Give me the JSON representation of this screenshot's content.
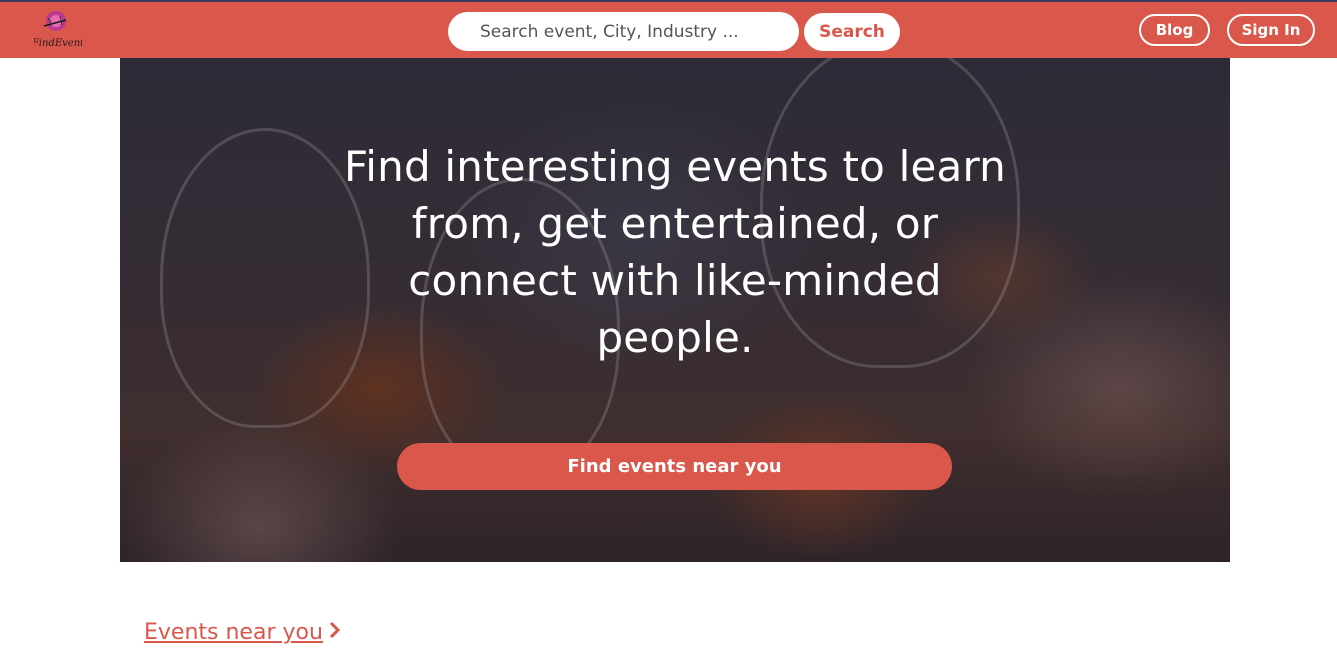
{
  "header": {
    "logo_text": "FindEvent",
    "search": {
      "placeholder": "Search event, City, Industry ...",
      "value": ""
    },
    "search_button": "Search",
    "nav": {
      "blog": "Blog",
      "sign_in": "Sign In"
    }
  },
  "hero": {
    "title": "Find interesting events to learn from, get entertained, or connect with like-minded people.",
    "cta": "Find events near you"
  },
  "main": {
    "events_near_you": "Events near you",
    "events_near_you_icon": "chevron-right-icon"
  },
  "colors": {
    "brand": "#d9574b",
    "topbar_border": "#3b3a5c",
    "text_light": "#ffffff"
  }
}
